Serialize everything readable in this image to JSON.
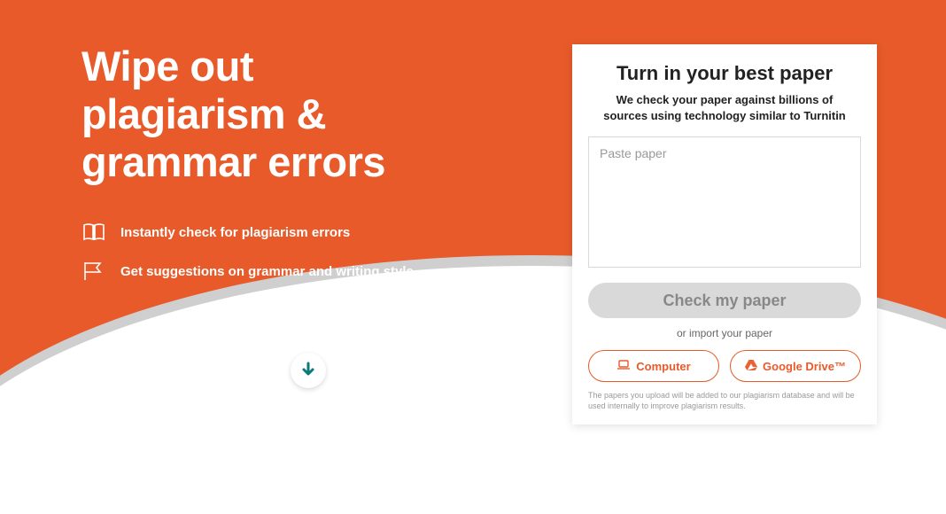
{
  "hero": {
    "headline_line1": "Wipe out",
    "headline_line2": "plagiarism &",
    "headline_line3": "grammar errors",
    "feature1": "Instantly check for plagiarism errors",
    "feature2": "Get suggestions on grammar and writing style"
  },
  "panel": {
    "title": "Turn in your best paper",
    "subtitle": "We check your paper against billions of sources using technology similar to Turnitin",
    "textarea_placeholder": "Paste paper",
    "check_button": "Check my paper",
    "or_text": "or import your paper",
    "computer_button": "Computer",
    "gdrive_button": "Google Drive™",
    "disclaimer": "The papers you upload will be added to our plagiarism database and will be used internally to improve plagiarism results."
  }
}
